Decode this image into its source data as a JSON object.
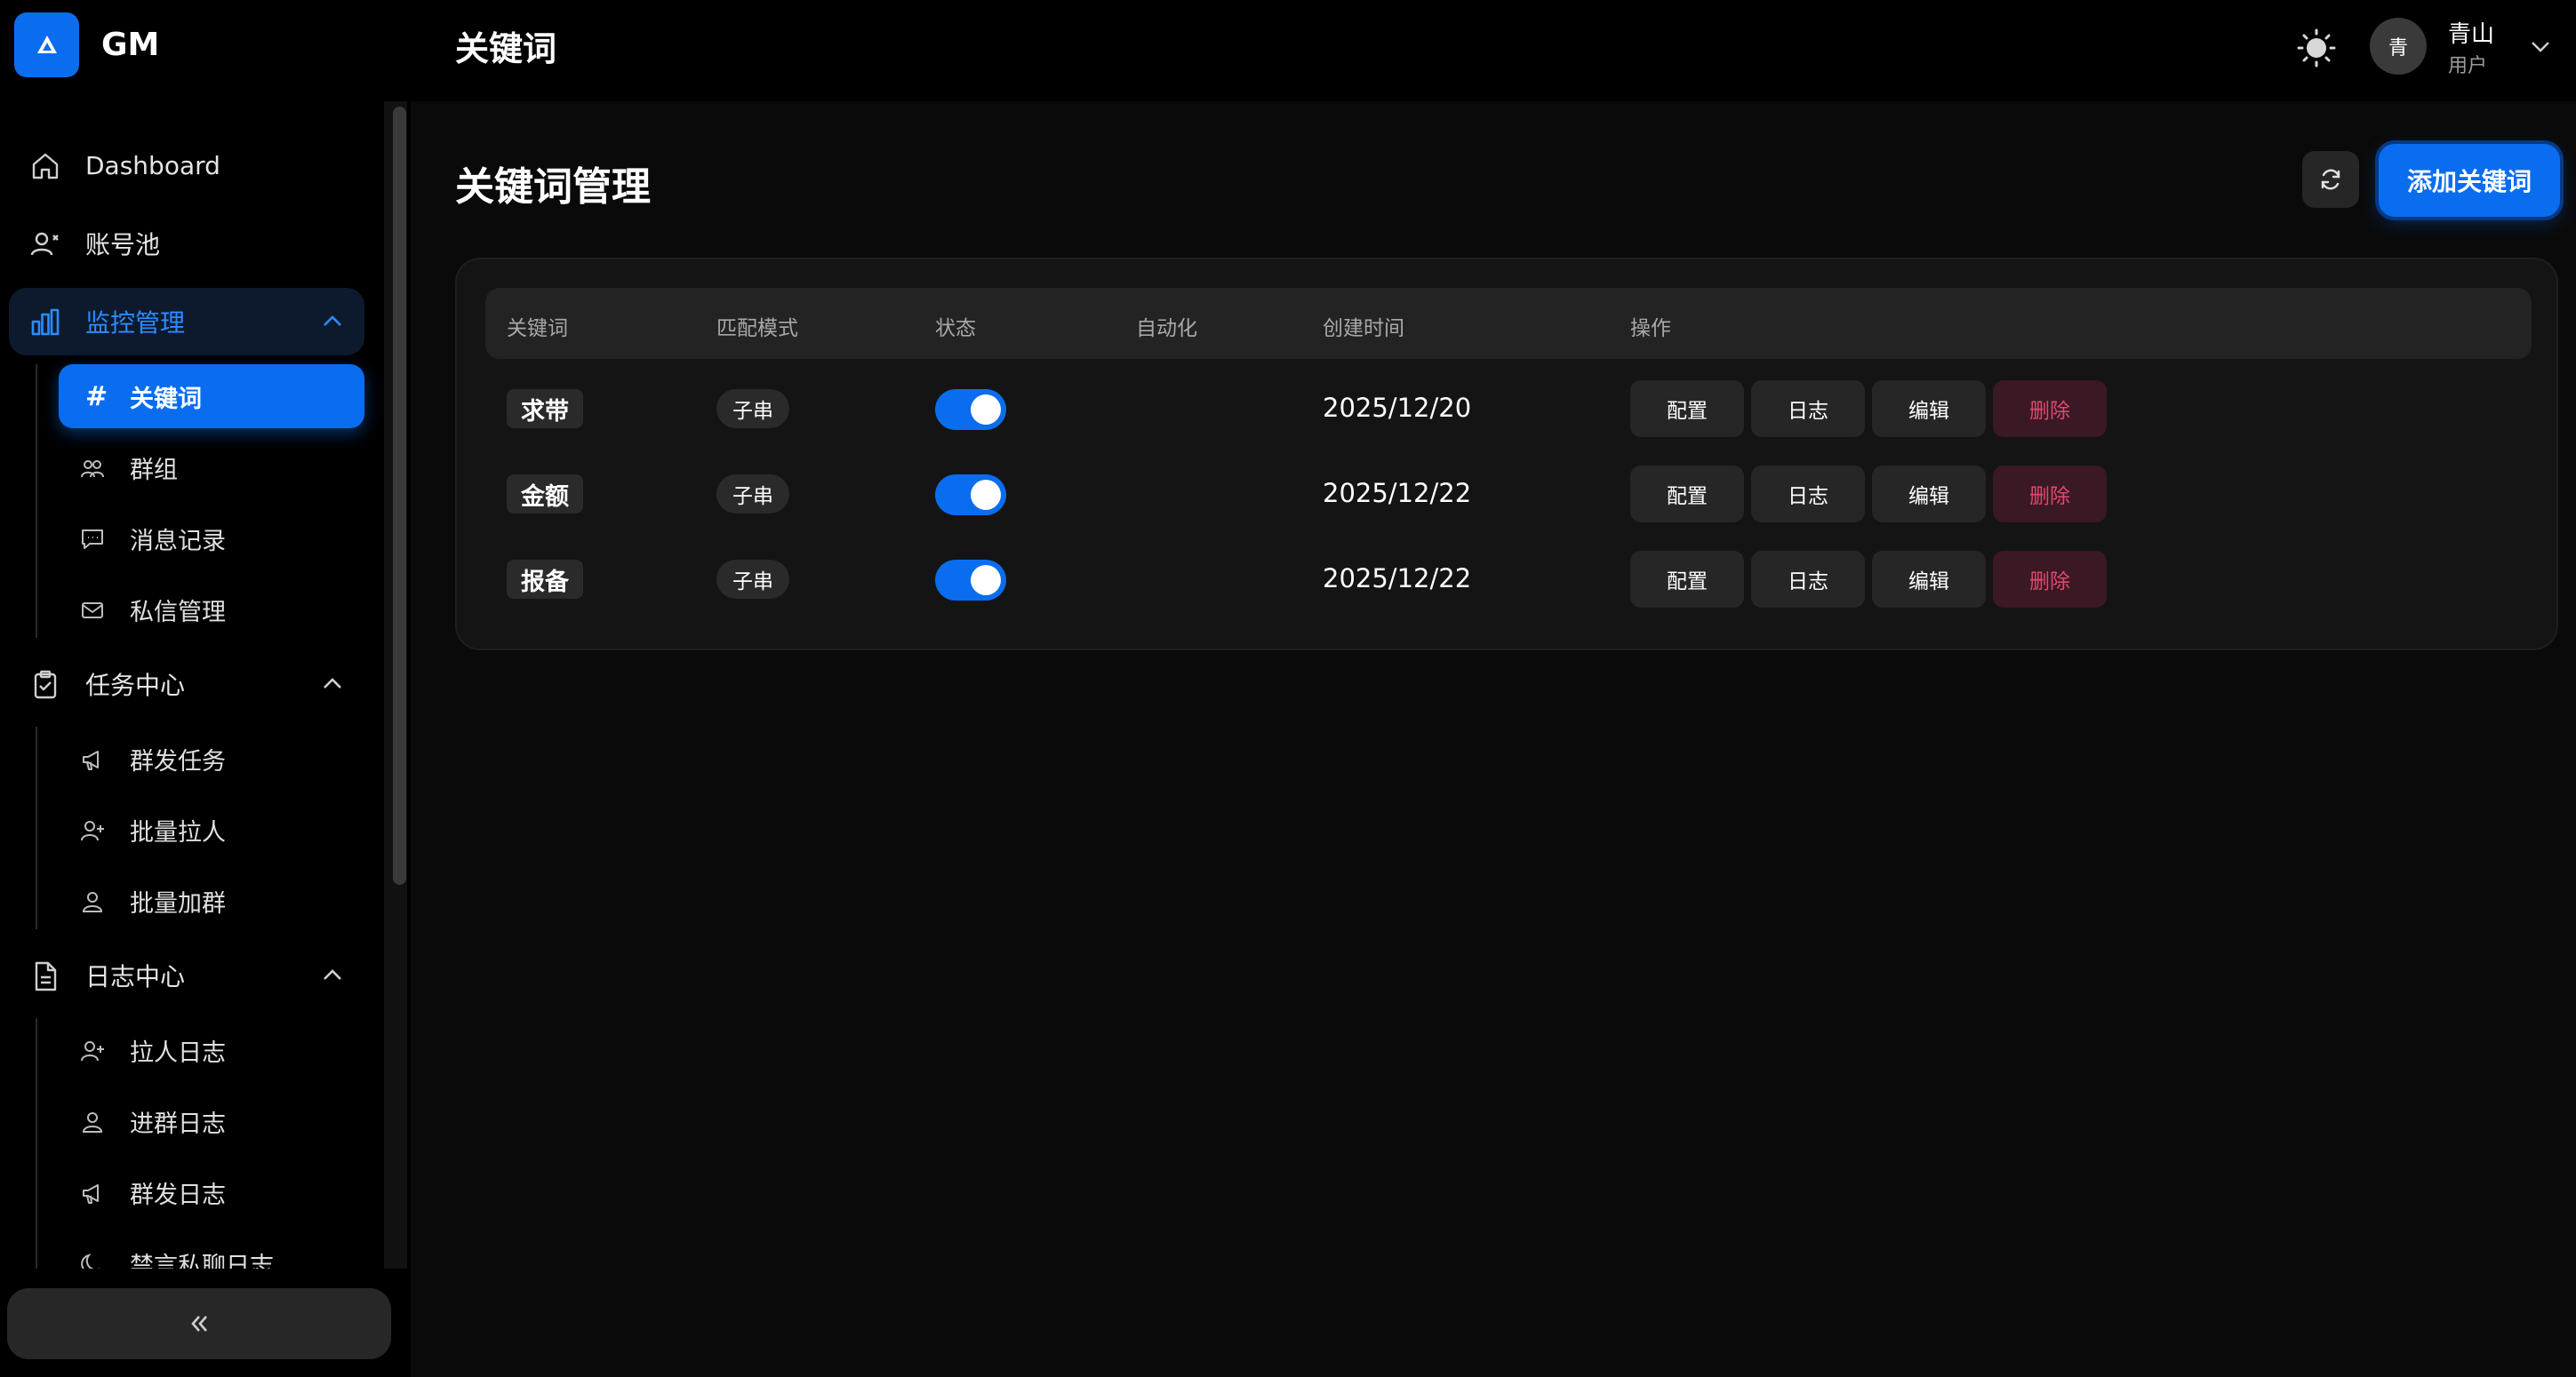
{
  "app": {
    "name": "GM"
  },
  "colors": {
    "accent": "#0a6df0",
    "danger": "#e5466e",
    "background": "#0a0a0a",
    "sidebar": "#000000"
  },
  "sidebar": {
    "items": [
      {
        "label": "Dashboard",
        "icon": "home-icon"
      },
      {
        "label": "账号池",
        "icon": "users-icon"
      },
      {
        "label": "监控管理",
        "icon": "bar-chart-icon",
        "expanded": true,
        "children": [
          {
            "label": "关键词",
            "icon": "hash-icon",
            "active": true
          },
          {
            "label": "群组",
            "icon": "group-icon"
          },
          {
            "label": "消息记录",
            "icon": "message-icon"
          },
          {
            "label": "私信管理",
            "icon": "mail-icon"
          }
        ]
      },
      {
        "label": "任务中心",
        "icon": "clipboard-icon",
        "expanded": true,
        "children": [
          {
            "label": "群发任务",
            "icon": "megaphone-icon"
          },
          {
            "label": "批量拉人",
            "icon": "user-plus-icon"
          },
          {
            "label": "批量加群",
            "icon": "user-group-icon"
          }
        ]
      },
      {
        "label": "日志中心",
        "icon": "file-icon",
        "expanded": true,
        "children": [
          {
            "label": "拉人日志",
            "icon": "user-plus-icon"
          },
          {
            "label": "进群日志",
            "icon": "user-group-icon"
          },
          {
            "label": "群发日志",
            "icon": "megaphone-icon"
          },
          {
            "label": "禁言私聊日志",
            "icon": "moon-icon"
          }
        ]
      }
    ],
    "collapse_icon": "chevrons-left-icon"
  },
  "header": {
    "title": "关键词",
    "user": {
      "avatar_text": "青",
      "name": "青山",
      "role": "用户"
    }
  },
  "main": {
    "title": "关键词管理",
    "add_button": "添加关键词",
    "table": {
      "columns": [
        "关键词",
        "匹配模式",
        "状态",
        "自动化",
        "创建时间",
        "操作"
      ],
      "rows": [
        {
          "keyword": "求带",
          "mode": "子串",
          "enabled": true,
          "automation": "",
          "created": "2025/12/20"
        },
        {
          "keyword": "金额",
          "mode": "子串",
          "enabled": true,
          "automation": "",
          "created": "2025/12/22"
        },
        {
          "keyword": "报备",
          "mode": "子串",
          "enabled": true,
          "automation": "",
          "created": "2025/12/22"
        }
      ],
      "actions": [
        "配置",
        "日志",
        "编辑",
        "删除"
      ]
    }
  }
}
